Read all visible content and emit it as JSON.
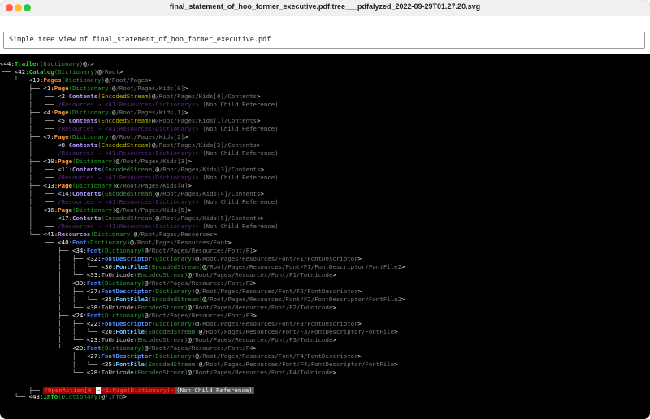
{
  "window": {
    "title": "final_statement_of_hoo_former_executive.pdf.tree___pdfalyzed_2022-09-29T01.27.20.svg"
  },
  "banner": {
    "text": "Simple tree view of final_statement_of_hoo_former_executive.pdf"
  },
  "tree_lines": [
    {
      "prefix": "",
      "id": "<44:",
      "key": "Trailer",
      "kcls": "k-trailer",
      "type": "Dictionary",
      "tcls": "t-dict",
      "path": "/",
      "suffix": ">"
    },
    {
      "prefix": "└── ",
      "id": "<42:",
      "key": "Catalog",
      "kcls": "k-catalog",
      "type": "Dictionary",
      "tcls": "t-dict",
      "path": "/Root",
      "suffix": ">"
    },
    {
      "prefix": "    └── ",
      "id": "<19:",
      "key": "Pages",
      "kcls": "k-pages",
      "type": "Dictionary",
      "tcls": "t-dict",
      "path": "/Root/Pages",
      "suffix": ">"
    },
    {
      "prefix": "        ├── ",
      "id": "<1:",
      "key": "Page",
      "kcls": "k-page",
      "type": "Dictionary",
      "tcls": "t-dict",
      "path": "/Root/Pages/Kids[0]",
      "suffix": ">"
    },
    {
      "prefix": "        │   ├── ",
      "id": "<2:",
      "key": "Contents",
      "kcls": "k-contents",
      "type": "EncodedStream",
      "tcls": "t-stream",
      "path": "/Root/Pages/Kids[0]/Contents",
      "suffix": ">"
    },
    {
      "prefix": "        │   └── ",
      "ref": "/Resources ⇒ <41:Resources(Dictionary)>",
      "nonchild": " (Non Child Reference)"
    },
    {
      "prefix": "        ├── ",
      "id": "<4:",
      "key": "Page",
      "kcls": "k-page",
      "type": "Dictionary",
      "tcls": "t-dict",
      "path": "/Root/Pages/Kids[1]",
      "suffix": ">"
    },
    {
      "prefix": "        │   ├── ",
      "id": "<5:",
      "key": "Contents",
      "kcls": "k-contents",
      "type": "EncodedStream",
      "tcls": "t-stream",
      "path": "/Root/Pages/Kids[1]/Contents",
      "suffix": ">"
    },
    {
      "prefix": "        │   └── ",
      "ref": "/Resources ⇒ <41:Resources(Dictionary)>",
      "nonchild": " (Non Child Reference)"
    },
    {
      "prefix": "        ├── ",
      "id": "<7:",
      "key": "Page",
      "kcls": "k-page",
      "type": "Dictionary",
      "tcls": "t-dict",
      "path": "/Root/Pages/Kids[2]",
      "suffix": ">"
    },
    {
      "prefix": "        │   ├── ",
      "id": "<8:",
      "key": "Contents",
      "kcls": "k-contents",
      "type": "EncodedStream",
      "tcls": "t-stream",
      "path": "/Root/Pages/Kids[2]/Contents",
      "suffix": ">"
    },
    {
      "prefix": "        │   └── ",
      "ref": "/Resources ⇒ <41:Resources(Dictionary)>",
      "nonchild": " (Non Child Reference)"
    },
    {
      "prefix": "        ├── ",
      "id": "<10:",
      "key": "Page",
      "kcls": "k-page",
      "type": "Dictionary",
      "tcls": "t-dict",
      "path": "/Root/Pages/Kids[3]",
      "suffix": ">"
    },
    {
      "prefix": "        │   ├── ",
      "id": "<11:",
      "key": "Contents",
      "kcls": "k-contents",
      "type": "EncodedStream",
      "tcls": "t-stream2",
      "path": "/Root/Pages/Kids[3]/Contents",
      "suffix": ">"
    },
    {
      "prefix": "        │   └── ",
      "ref": "/Resources ⇒ <41:Resources(Dictionary)>",
      "nonchild": " (Non Child Reference)"
    },
    {
      "prefix": "        ├── ",
      "id": "<13:",
      "key": "Page",
      "kcls": "k-page",
      "type": "Dictionary",
      "tcls": "t-dict",
      "path": "/Root/Pages/Kids[4]",
      "suffix": ">"
    },
    {
      "prefix": "        │   ├── ",
      "id": "<14:",
      "key": "Contents",
      "kcls": "k-contents",
      "type": "EncodedStream",
      "tcls": "t-stream2",
      "path": "/Root/Pages/Kids[4]/Contents",
      "suffix": ">"
    },
    {
      "prefix": "        │   └── ",
      "ref": "/Resources ⇒ <41:Resources(Dictionary)>",
      "nonchild": " (Non Child Reference)"
    },
    {
      "prefix": "        ├── ",
      "id": "<16:",
      "key": "Page",
      "kcls": "k-page",
      "type": "Dictionary",
      "tcls": "t-dict",
      "path": "/Root/Pages/Kids[5]",
      "suffix": ">"
    },
    {
      "prefix": "        │   ├── ",
      "id": "<17:",
      "key": "Contents",
      "kcls": "k-contents",
      "type": "EncodedStream",
      "tcls": "t-stream2",
      "path": "/Root/Pages/Kids[5]/Contents",
      "suffix": ">"
    },
    {
      "prefix": "        │   └── ",
      "ref": "/Resources ⇒ <41:Resources(Dictionary)>",
      "nonchild": " (Non Child Reference)"
    },
    {
      "prefix": "        └── ",
      "id": "<41:",
      "key": "Resources",
      "kcls": "k-resources",
      "type": "Dictionary",
      "tcls": "t-dict",
      "path": "/Root/Pages/Resources",
      "suffix": ">"
    },
    {
      "prefix": "            └── ",
      "id": "<40:",
      "key": "Font",
      "kcls": "k-font",
      "type": "Dictionary",
      "tcls": "t-dict",
      "path": "/Root/Pages/Resources/Font",
      "suffix": ">"
    },
    {
      "prefix": "                ├── ",
      "id": "<34:",
      "key": "Font",
      "kcls": "k-font",
      "type": "Dictionary",
      "tcls": "t-dict",
      "path": "/Root/Pages/Resources/Font/F1",
      "suffix": ">"
    },
    {
      "prefix": "                │   ├── ",
      "id": "<32:",
      "key": "FontDescriptor",
      "kcls": "k-fontdesc",
      "type": "Dictionary",
      "tcls": "t-dict",
      "path": "/Root/Pages/Resources/Font/F1/FontDescriptor",
      "suffix": ">"
    },
    {
      "prefix": "                │   │   └── ",
      "id": "<30:",
      "key": "FontFile2",
      "kcls": "k-fontfile",
      "type": "EncodedStream",
      "tcls": "t-stream2",
      "path": "/Root/Pages/Resources/Font/F1/FontDescriptor/FontFile2",
      "suffix": ">"
    },
    {
      "prefix": "                │   └── ",
      "id": "<33:",
      "key": "ToUnicode",
      "kcls": "k-touni",
      "type": "EncodedStream",
      "tcls": "t-stream2",
      "path": "/Root/Pages/Resources/Font/F1/ToUnicode",
      "suffix": ">"
    },
    {
      "prefix": "                ├── ",
      "id": "<39:",
      "key": "Font",
      "kcls": "k-font",
      "type": "Dictionary",
      "tcls": "t-dict",
      "path": "/Root/Pages/Resources/Font/F2",
      "suffix": ">"
    },
    {
      "prefix": "                │   ├── ",
      "id": "<37:",
      "key": "FontDescriptor",
      "kcls": "k-fontdesc",
      "type": "Dictionary",
      "tcls": "t-dict",
      "path": "/Root/Pages/Resources/Font/F2/FontDescriptor",
      "suffix": ">"
    },
    {
      "prefix": "                │   │   └── ",
      "id": "<35:",
      "key": "FontFile2",
      "kcls": "k-fontfile",
      "type": "EncodedStream",
      "tcls": "t-stream2",
      "path": "/Root/Pages/Resources/Font/F2/FontDescriptor/FontFile2",
      "suffix": ">"
    },
    {
      "prefix": "                │   └── ",
      "id": "<38:",
      "key": "ToUnicode",
      "kcls": "k-touni",
      "type": "EncodedStream",
      "tcls": "t-stream2",
      "path": "/Root/Pages/Resources/Font/F2/ToUnicode",
      "suffix": ">"
    },
    {
      "prefix": "                ├── ",
      "id": "<24:",
      "key": "Font",
      "kcls": "k-font",
      "type": "Dictionary",
      "tcls": "t-dict",
      "path": "/Root/Pages/Resources/Font/F3",
      "suffix": ">"
    },
    {
      "prefix": "                │   ├── ",
      "id": "<22:",
      "key": "FontDescriptor",
      "kcls": "k-fontdesc",
      "type": "Dictionary",
      "tcls": "t-dict",
      "path": "/Root/Pages/Resources/Font/F3/FontDescriptor",
      "suffix": ">"
    },
    {
      "prefix": "                │   │   └── ",
      "id": "<20:",
      "key": "FontFile",
      "kcls": "k-fontfile",
      "type": "EncodedStream",
      "tcls": "t-stream2",
      "path": "/Root/Pages/Resources/Font/F3/FontDescriptor/FontFile",
      "suffix": ">"
    },
    {
      "prefix": "                │   └── ",
      "id": "<23:",
      "key": "ToUnicode",
      "kcls": "k-touni",
      "type": "EncodedStream",
      "tcls": "t-stream2",
      "path": "/Root/Pages/Resources/Font/F3/ToUnicode",
      "suffix": ">"
    },
    {
      "prefix": "                └── ",
      "id": "<29:",
      "key": "Font",
      "kcls": "k-font",
      "type": "Dictionary",
      "tcls": "t-dict",
      "path": "/Root/Pages/Resources/Font/F4",
      "suffix": ">"
    },
    {
      "prefix": "                    ├── ",
      "id": "<27:",
      "key": "FontDescriptor",
      "kcls": "k-fontdesc",
      "type": "Dictionary",
      "tcls": "t-dict",
      "path": "/Root/Pages/Resources/Font/F4/FontDescriptor",
      "suffix": ">"
    },
    {
      "prefix": "                    │   └── ",
      "id": "<25:",
      "key": "FontFile",
      "kcls": "k-fontfile",
      "type": "EncodedStream",
      "tcls": "t-stream2",
      "path": "/Root/Pages/Resources/Font/F4/FontDescriptor/FontFile",
      "suffix": ">"
    },
    {
      "prefix": "                    └── ",
      "id": "<28:",
      "key": "ToUnicode",
      "kcls": "k-touni",
      "type": "EncodedStream",
      "tcls": "t-stream2",
      "path": "/Root/Pages/Resources/Font/F4/ToUnicode",
      "suffix": ">"
    }
  ],
  "openaction": {
    "prefix": "    ├── ",
    "label": "/OpenAction[0]",
    "arrow": "⇒",
    "target": "<1:Page(Dictionary)>",
    "note": "(Non Child Reference)"
  },
  "info_line": {
    "prefix": "└── ",
    "id": "<43:",
    "key": "Info",
    "type": "Dictionary",
    "path": "/Info",
    "suffix": ">"
  },
  "colors": {
    "background": "#000000",
    "dict_type": "#2aa02a",
    "stream_type": "#c0b400",
    "path": "#7a7a7a",
    "openaction_bg": "#a40000"
  }
}
